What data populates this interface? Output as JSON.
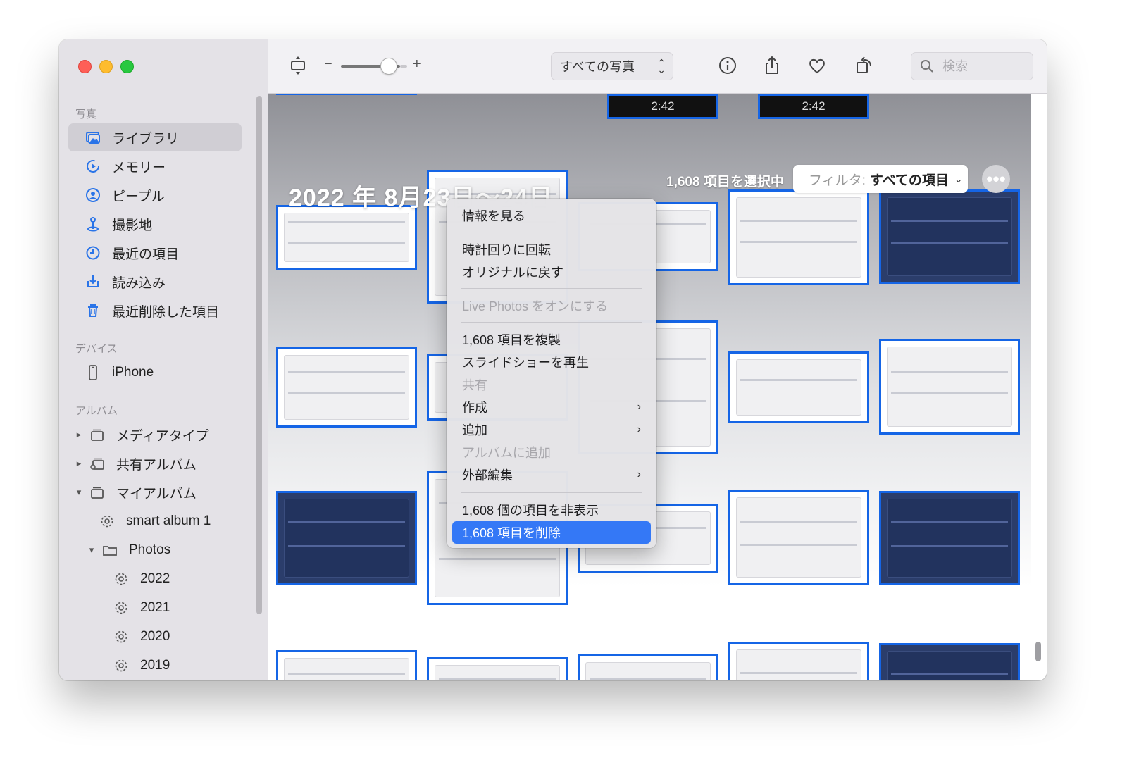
{
  "sidebar": {
    "sections": [
      {
        "title": "写真"
      },
      {
        "title": "デバイス"
      },
      {
        "title": "アルバム"
      }
    ],
    "library_items": [
      {
        "label": "ライブラリ",
        "icon": "photo-library-icon"
      },
      {
        "label": "メモリー",
        "icon": "memories-icon"
      },
      {
        "label": "ピープル",
        "icon": "people-icon"
      },
      {
        "label": "撮影地",
        "icon": "places-icon"
      },
      {
        "label": "最近の項目",
        "icon": "clock-icon"
      },
      {
        "label": "読み込み",
        "icon": "import-icon"
      },
      {
        "label": "最近削除した項目",
        "icon": "trash-icon"
      }
    ],
    "devices": [
      {
        "label": "iPhone",
        "icon": "iphone-icon"
      }
    ],
    "albums": [
      {
        "label": "メディアタイプ",
        "icon": "folder-stack-icon"
      },
      {
        "label": "共有アルバム",
        "icon": "shared-album-icon"
      },
      {
        "label": "マイアルバム",
        "icon": "folder-stack-icon"
      },
      {
        "label": "smart album 1",
        "icon": "smart-album-gear-icon"
      },
      {
        "label": "Photos",
        "icon": "folder-icon"
      },
      {
        "label": "2022",
        "icon": "smart-album-gear-icon"
      },
      {
        "label": "2021",
        "icon": "smart-album-gear-icon"
      },
      {
        "label": "2020",
        "icon": "smart-album-gear-icon"
      },
      {
        "label": "2019",
        "icon": "smart-album-gear-icon"
      }
    ]
  },
  "toolbar": {
    "zoom_minus": "−",
    "zoom_plus": "+",
    "zoom_level": 0.7,
    "view_popup": "すべての写真",
    "search_placeholder": "検索"
  },
  "grid": {
    "date_title": "2022 年 8月23日〜24日",
    "selection_count": "1,608 項目を選択中",
    "filter_label": "フィルタ:",
    "filter_value": "すべての項目",
    "video_durations": [
      "2:42",
      "2:42"
    ]
  },
  "context_menu": {
    "items": [
      {
        "label": "情報を見る"
      },
      {
        "label": "時計回りに回転"
      },
      {
        "label": "オリジナルに戻す"
      },
      {
        "label": "Live Photos をオンにする"
      },
      {
        "label": "1,608 項目を複製"
      },
      {
        "label": "スライドショーを再生"
      },
      {
        "label": "共有"
      },
      {
        "label": "作成"
      },
      {
        "label": "追加"
      },
      {
        "label": "アルバムに追加"
      },
      {
        "label": "外部編集"
      },
      {
        "label": "1,608 個の項目を非表示"
      },
      {
        "label": "1,608 項目を削除"
      }
    ],
    "arrow": "›"
  },
  "colors": {
    "accent": "#3478f6",
    "selection_border": "#1565e6",
    "sidebar_bg": "#e4e2e7"
  }
}
